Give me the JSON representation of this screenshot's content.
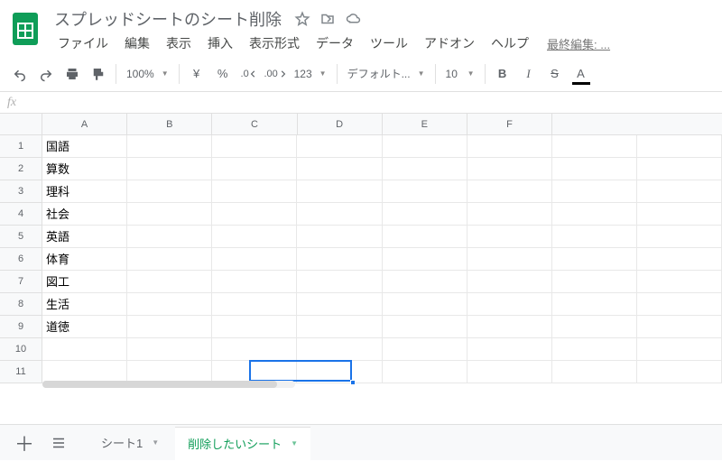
{
  "doc": {
    "title": "スプレッドシートのシート削除",
    "last_edit": "最終編集: ..."
  },
  "menu": {
    "file": "ファイル",
    "edit": "編集",
    "view": "表示",
    "insert": "挿入",
    "format": "表示形式",
    "data": "データ",
    "tools": "ツール",
    "addons": "アドオン",
    "help": "ヘルプ"
  },
  "toolbar": {
    "zoom": "100%",
    "currency": "¥",
    "percent": "%",
    "dec_dec": ".0←",
    "dec_inc": ".00→",
    "num_fmt": "123",
    "font": "デフォルト...",
    "font_size": "10",
    "bold": "B",
    "italic": "I",
    "strike": "S",
    "text_color": "A"
  },
  "fx": "fx",
  "columns": [
    "A",
    "B",
    "C",
    "D",
    "E",
    "F"
  ],
  "row_count": 11,
  "cells_A": [
    "国語",
    "算数",
    "理科",
    "社会",
    "英語",
    "体育",
    "図工",
    "生活",
    "道徳",
    "",
    ""
  ],
  "selection": {
    "row": 11,
    "col": "C"
  },
  "tabs": {
    "sheet1": "シート1",
    "sheet2": "削除したいシート"
  },
  "active_tab_index": 1
}
